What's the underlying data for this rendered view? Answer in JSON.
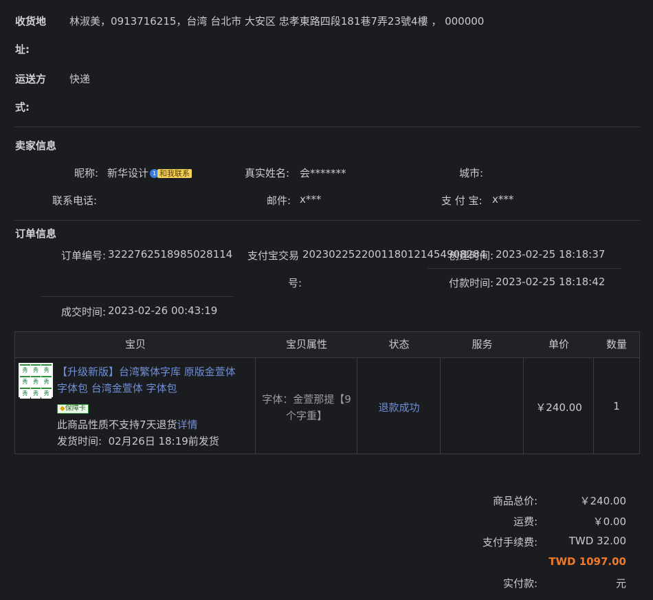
{
  "shipping": {
    "address_label_1": "收货地",
    "address_label_2": "址:",
    "address_value": "林淑美，0913716215，台湾 台北市 大安区 忠孝東路四段181巷7弄23號4樓 ， 000000",
    "method_label_1": "运送方",
    "method_label_2": "式:",
    "method_value": "快递"
  },
  "seller": {
    "section_title": "卖家信息",
    "nickname_label": "昵称:",
    "nickname_value": "新华设计",
    "contact_badge_num": "1",
    "contact_badge_text": "和我联系",
    "realname_label": "真实姓名:",
    "realname_value": "会*******",
    "city_label": "城市:",
    "city_value": "",
    "phone_label": "联系电话:",
    "phone_value": "",
    "email_label": "邮件:",
    "email_value": "x***",
    "alipay_label": "支 付 宝:",
    "alipay_value": "x***"
  },
  "order": {
    "section_title": "订单信息",
    "order_no_label": "订单编号:",
    "order_no_value": "3222762518985028114",
    "alipay_tx_label_1": "支付宝交易",
    "alipay_tx_label_2": "号:",
    "alipay_tx_value": "2023022522001180121454908284",
    "created_label": "创建时间:",
    "created_value": "2023-02-25 18:18:37",
    "paid_label": "付款时间:",
    "paid_value": "2023-02-25 18:18:42",
    "deal_label": "成交时间:",
    "deal_value": "2023-02-26 00:43:19"
  },
  "table": {
    "headers": [
      "宝贝",
      "宝贝属性",
      "状态",
      "服务",
      "单价",
      "数量"
    ],
    "item": {
      "title_line1": "【升级新版】台湾繁体字库 原版金萱体",
      "title_line2": "字体包 台湾金萱体 字体包",
      "thumb_glyph": "秀",
      "guarantee_badge": "保障卡",
      "return_note": "此商品性质不支持7天退货",
      "return_link": "详情",
      "ship_label": "发货时间:",
      "ship_value": "02月26日 18:19前发货",
      "attr_line1": "字体：金萱那提【9",
      "attr_line2": "个字重】",
      "status": "退款成功",
      "service": "",
      "price": "￥240.00",
      "qty": "1"
    }
  },
  "summary": {
    "subtotal_label": "商品总价:",
    "subtotal_value": "￥240.00",
    "shipping_label": "运费:",
    "shipping_value": "￥0.00",
    "fee_label": "支付手续费:",
    "fee_value": "TWD 32.00",
    "total_value": "TWD 1097.00",
    "paid_label": "实付款:",
    "paid_unit": "元"
  },
  "colors": {
    "background": "#1b1c1f",
    "link": "#6f8fd6",
    "total_orange": "#f07a2a"
  }
}
